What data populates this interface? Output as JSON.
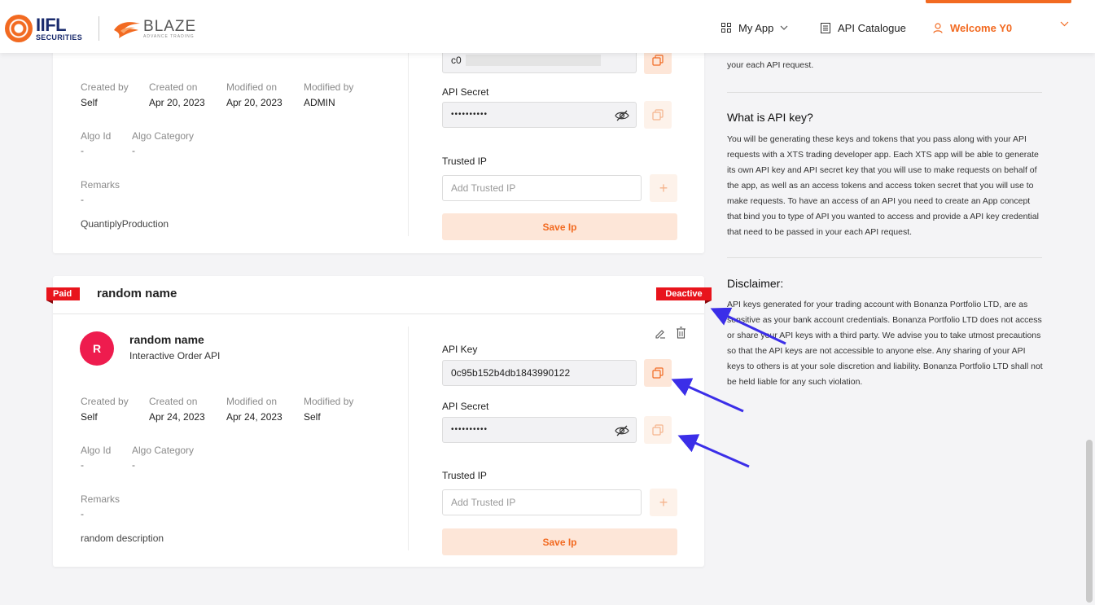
{
  "header": {
    "brand_iifl": "IIFL",
    "brand_iifl_sub": "SECURITIES",
    "brand_blaze": "BLAZE",
    "brand_blaze_sub": "ADVANCE TRADING",
    "nav_myapp": "My App",
    "nav_catalogue": "API Catalogue",
    "nav_welcome": "Welcome Y0",
    "accent": "#f26a21"
  },
  "card1": {
    "api_key_value": "c0",
    "api_secret_label": "API Secret",
    "api_secret_value": "••••••••••",
    "trusted_ip_label": "Trusted IP",
    "trusted_ip_placeholder": "Add Trusted IP",
    "save_label": "Save Ip",
    "meta": {
      "created_by_label": "Created by",
      "created_by": "Self",
      "created_on_label": "Created on",
      "created_on": "Apr 20, 2023",
      "modified_on_label": "Modified on",
      "modified_on": "Apr 20, 2023",
      "modified_by_label": "Modified by",
      "modified_by": "ADMIN",
      "algo_id_label": "Algo Id",
      "algo_id": "-",
      "algo_category_label": "Algo Category",
      "algo_category": "-",
      "remarks_label": "Remarks",
      "remarks": "-",
      "description": "QuantiplyProduction"
    }
  },
  "card2": {
    "paid_label": "Paid",
    "title": "random name",
    "status_label": "Deactive",
    "avatar_letter": "R",
    "app_name": "random name",
    "app_type": "Interactive Order API",
    "api_key_label": "API Key",
    "api_key_value": "0c95b152b4db1843990122",
    "api_secret_label": "API Secret",
    "api_secret_value": "••••••••••",
    "trusted_ip_label": "Trusted IP",
    "trusted_ip_placeholder": "Add Trusted IP",
    "save_label": "Save Ip",
    "meta": {
      "created_by_label": "Created by",
      "created_by": "Self",
      "created_on_label": "Created on",
      "created_on": "Apr 24, 2023",
      "modified_on_label": "Modified on",
      "modified_on": "Apr 24, 2023",
      "modified_by_label": "Modified by",
      "modified_by": "Self",
      "algo_id_label": "Algo Id",
      "algo_id": "-",
      "algo_category_label": "Algo Category",
      "algo_category": "-",
      "remarks_label": "Remarks",
      "remarks": "-",
      "description": "random description"
    }
  },
  "info": {
    "top_fragment": "your each API request.",
    "what_heading": "What is API key?",
    "what_text": "You will be generating these keys and tokens that you pass along with your API requests with a XTS trading developer app. Each XTS app will be able to generate its own API key and API secret key that you will use to make requests on behalf of the app, as well as an access tokens and access token secret that you will use to make requests. To have an access of an API you need to create an App concept that bind you to type of API you wanted to access and provide a API key credential that need to be passed in your each API request.",
    "disclaimer_heading": "Disclaimer:",
    "disclaimer_text": "API keys generated for your trading account with Bonanza Portfolio LTD, are as sensitive as your bank account credentials. Bonanza Portfolio LTD does not access or share your API keys with a third party. We advise you to take utmost precautions so that the API keys are not accessible to anyone else. Any sharing of your API keys to others is at your sole discretion and liability. Bonanza Portfolio LTD shall not be held liable for any such violation."
  }
}
